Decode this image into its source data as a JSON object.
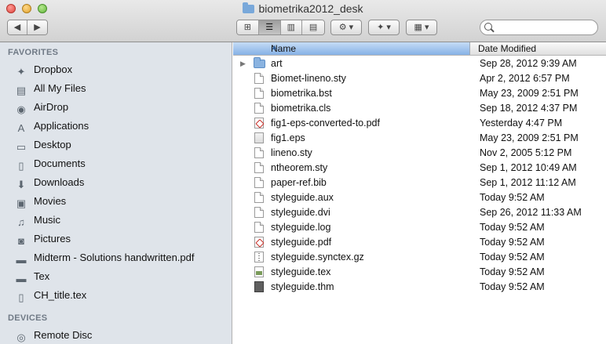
{
  "window": {
    "title": "biometrika2012_desk"
  },
  "toolbar": {
    "back_label": "◀",
    "forward_label": "▶",
    "view_icons": [
      "icon-view-icon",
      "list-view-icon",
      "column-view-icon",
      "coverflow-view-icon"
    ],
    "view_glyphs": [
      "⊞",
      "☰",
      "▥",
      "▤"
    ],
    "action_label": "⚙ ▾",
    "dropbox_label": "✦ ▾",
    "arrange_label": "▦ ▾",
    "search_placeholder": ""
  },
  "sidebar": {
    "favorites_label": "FAVORITES",
    "devices_label": "DEVICES",
    "favorites": [
      {
        "label": "Dropbox",
        "icon": "dropbox-icon",
        "glyph": "✦"
      },
      {
        "label": "All My Files",
        "icon": "all-files-icon",
        "glyph": "▤"
      },
      {
        "label": "AirDrop",
        "icon": "airdrop-icon",
        "glyph": "◉"
      },
      {
        "label": "Applications",
        "icon": "applications-icon",
        "glyph": "A"
      },
      {
        "label": "Desktop",
        "icon": "desktop-icon",
        "glyph": "▭"
      },
      {
        "label": "Documents",
        "icon": "documents-icon",
        "glyph": "▯"
      },
      {
        "label": "Downloads",
        "icon": "downloads-icon",
        "glyph": "⬇"
      },
      {
        "label": "Movies",
        "icon": "movies-icon",
        "glyph": "▣"
      },
      {
        "label": "Music",
        "icon": "music-icon",
        "glyph": "♫"
      },
      {
        "label": "Pictures",
        "icon": "pictures-icon",
        "glyph": "◙"
      },
      {
        "label": "Midterm - Solutions handwritten.pdf",
        "icon": "folder-icon",
        "glyph": "▬"
      },
      {
        "label": "Tex",
        "icon": "folder-icon",
        "glyph": "▬"
      },
      {
        "label": "CH_title.tex",
        "icon": "document-icon",
        "glyph": "▯"
      }
    ],
    "devices": [
      {
        "label": "Remote Disc",
        "icon": "remote-disc-icon",
        "glyph": "◎"
      }
    ]
  },
  "list": {
    "columns": {
      "name": "Name",
      "date": "Date Modified"
    },
    "sort_indicator": "▲",
    "rows": [
      {
        "name": "art",
        "date": "Sep 28, 2012 9:39 AM",
        "kind": "folder"
      },
      {
        "name": "Biomet-lineno.sty",
        "date": "Apr 2, 2012 6:57 PM",
        "kind": "doc"
      },
      {
        "name": "biometrika.bst",
        "date": "May 23, 2009 2:51 PM",
        "kind": "doc"
      },
      {
        "name": "biometrika.cls",
        "date": "Sep 18, 2012 4:37 PM",
        "kind": "doc"
      },
      {
        "name": "fig1-eps-converted-to.pdf",
        "date": "Yesterday 4:47 PM",
        "kind": "pdf"
      },
      {
        "name": "fig1.eps",
        "date": "May 23, 2009 2:51 PM",
        "kind": "eps"
      },
      {
        "name": "lineno.sty",
        "date": "Nov 2, 2005 5:12 PM",
        "kind": "doc"
      },
      {
        "name": "ntheorem.sty",
        "date": "Sep 1, 2012 10:49 AM",
        "kind": "doc"
      },
      {
        "name": "paper-ref.bib",
        "date": "Sep 1, 2012 11:12 AM",
        "kind": "doc"
      },
      {
        "name": "styleguide.aux",
        "date": "Today 9:52 AM",
        "kind": "doc"
      },
      {
        "name": "styleguide.dvi",
        "date": "Sep 26, 2012 11:33 AM",
        "kind": "doc"
      },
      {
        "name": "styleguide.log",
        "date": "Today 9:52 AM",
        "kind": "doc"
      },
      {
        "name": "styleguide.pdf",
        "date": "Today 9:52 AM",
        "kind": "pdf"
      },
      {
        "name": "styleguide.synctex.gz",
        "date": "Today 9:52 AM",
        "kind": "gz"
      },
      {
        "name": "styleguide.tex",
        "date": "Today 9:52 AM",
        "kind": "tex"
      },
      {
        "name": "styleguide.thm",
        "date": "Today 9:52 AM",
        "kind": "thm"
      }
    ]
  },
  "colors": {
    "sidebar_bg": "#dfe4ea",
    "header_selected": "#86b1e6",
    "pdf_red": "#c8322b",
    "folder_blue": "#8ab3e0"
  }
}
